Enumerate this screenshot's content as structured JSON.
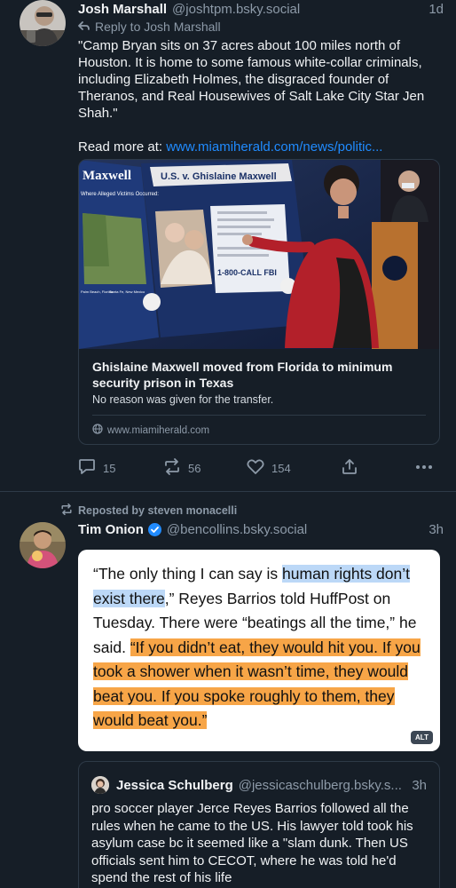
{
  "post1": {
    "author_name": "Josh Marshall",
    "author_handle": "@joshtpm.bsky.social",
    "time": "1d",
    "reply_to": "Reply to Josh Marshall",
    "text": "\"Camp Bryan sits on 37 acres about 100 miles north of Houston. It is home to some famous white-collar criminals, including Elizabeth Holmes, the disgraced founder of Theranos, and Real Housewives of Salt Lake City Star Jen Shah.\"",
    "read_more_prefix": "Read more at: ",
    "read_more_link": "www.miamiherald.com/news/politic...",
    "card": {
      "image_texts": {
        "left_board_title": "Maxwell",
        "left_board_sub": "Where Alleged Victims Occurred:",
        "left_caption_1": "Palm Beach, Florida",
        "left_caption_2": "Santa Fe, New Mexico",
        "board_title": "U.S. v. Ghislaine Maxwell",
        "hotline": "1-800-CALL FBI"
      },
      "title": "Ghislaine Maxwell moved from Florida to minimum security prison in Texas",
      "description": "No reason was given for the transfer.",
      "domain": "www.miamiherald.com"
    },
    "actions": {
      "replies": "15",
      "reposts": "56",
      "likes": "154"
    }
  },
  "post2": {
    "repost_label": "Reposted by steven monacelli",
    "author_name": "Tim Onion",
    "author_handle": "@bencollins.bsky.social",
    "time": "3h",
    "quote_image": {
      "part1": "“The only thing I can say is ",
      "part2_highlight": "human rights don’t exist there",
      "part3": ",” Reyes Barrios told HuffPost on Tuesday. There were “beatings all the time,” he said. ",
      "part4_highlight": "“If you didn’t eat, they would hit you. If you took a shower when it wasn’t time, they would beat you. If you spoke roughly to them, they would beat you.”",
      "alt_badge": "ALT"
    },
    "embed": {
      "author_name": "Jessica Schulberg",
      "author_handle": "@jessicaschulberg.bsky.s...",
      "time": "3h",
      "text": "pro soccer player Jerce Reyes Barrios followed all the rules when he came to the US. His lawyer told took his asylum case bc it seemed like a \"slam dunk. Then US officials sent him to CECOT, where he was told he'd spend the rest of his life"
    }
  },
  "colors": {
    "background": "#161e27",
    "border": "#2e3a47",
    "muted": "#8d9aa8",
    "link": "#208bfe",
    "verified": "#208bfe",
    "highlight_blue": "#bcd8f7",
    "highlight_orange": "#f7a547"
  },
  "icons": [
    "reply-arrow-icon",
    "reply-icon",
    "repost-icon",
    "like-icon",
    "share-icon",
    "more-icon",
    "globe-icon",
    "verified-badge-icon"
  ]
}
